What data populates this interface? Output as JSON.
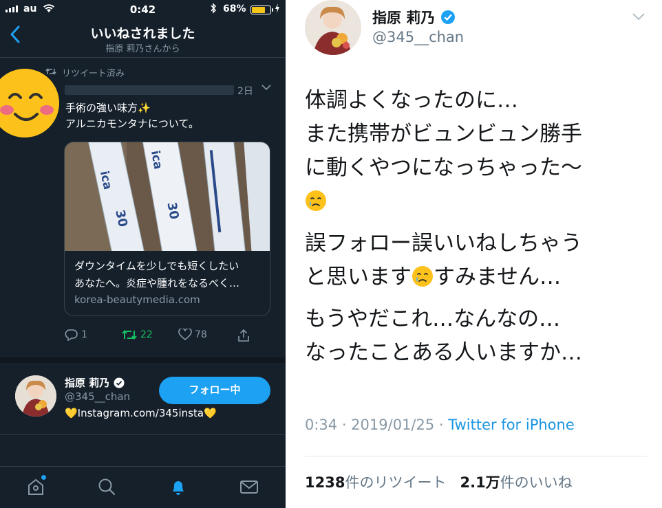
{
  "status_bar": {
    "carrier": "au",
    "time": "0:42",
    "battery_percent": "68%",
    "battery_level": 0.68
  },
  "header": {
    "title": "いいねされました",
    "subtitle": "指原 莉乃さんから",
    "back_icon": "chevron-left-icon"
  },
  "notification_tweet": {
    "retweeted_label": "リツイート済み",
    "time": "2日",
    "text_line1": "手術の強い味方✨",
    "text_line2": "アルニカモンタナについて。",
    "card": {
      "description_line1": "ダウンタイムを少しでも短くしたい",
      "description_line2": "あなたへ。炎症や腫れをなるべく…",
      "domain": "korea-beautymedia.com"
    },
    "actions": {
      "reply_count": "1",
      "retweet_count": "22",
      "like_count": "78"
    }
  },
  "user": {
    "name": "指原 莉乃",
    "handle": "@345__chan",
    "bio": "💛Instagram.com/345insta💛",
    "follow_label": "フォロー中"
  },
  "tabbar": {
    "items": [
      "home-icon",
      "search-icon",
      "notifications-icon",
      "messages-icon"
    ]
  },
  "tweet_detail": {
    "name": "指原 莉乃",
    "handle": "@345__chan",
    "para1_line1": "体調よくなったのに…",
    "para1_line2": "また携帯がビュンビュン勝手",
    "para1_line3": "に動くやつになっちゃった〜",
    "para2_line1": "誤フォロー誤いいねしちゃう",
    "para2_line2a": "と思います",
    "para2_line2b": "すみません…",
    "para3_line1": "もうやだこれ…なんなの…",
    "para3_line2": "なったことある人いますか…",
    "timestamp": "0:34 · 2019/01/25 · ",
    "source": "Twitter for iPhone",
    "retweet_count": "1238",
    "retweet_label": "件のリツイート",
    "like_count": "2.1万",
    "like_label": "件のいいね"
  },
  "colors": {
    "dark_bg": "#15202b",
    "accent": "#1da1f2",
    "retweet_green": "#17bf63",
    "muted": "#8899a6"
  }
}
